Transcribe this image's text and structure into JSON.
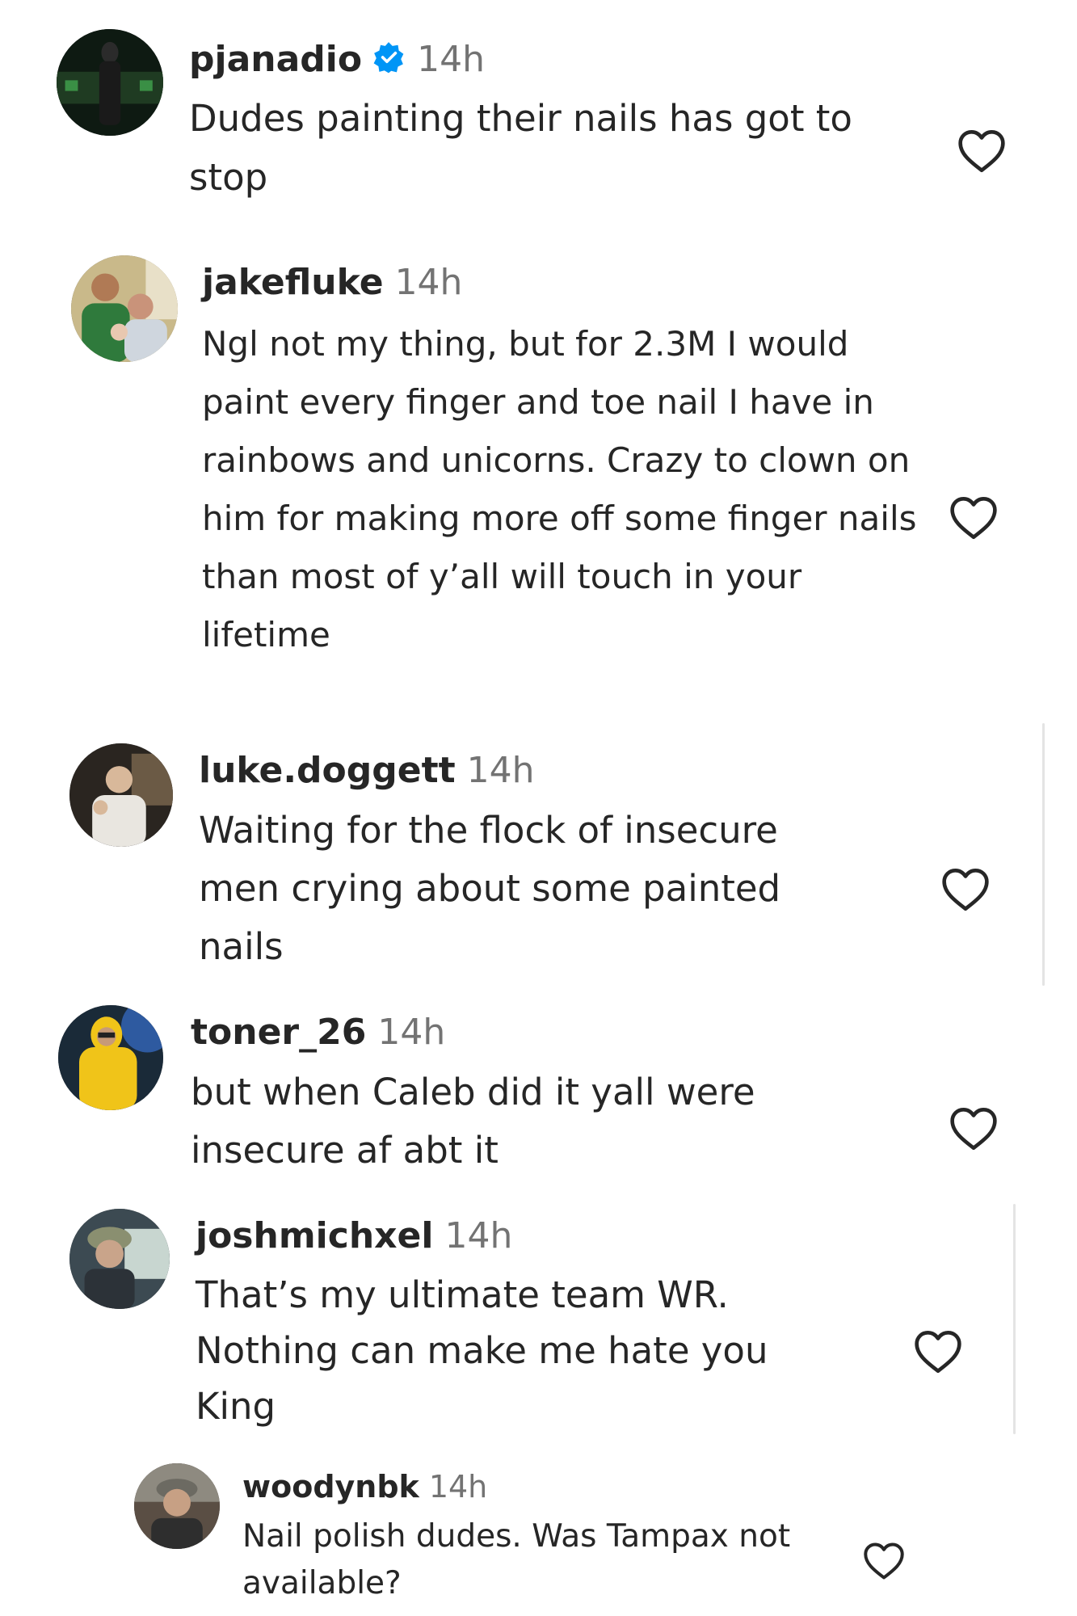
{
  "comments": [
    {
      "username": "pjanadio",
      "verified": true,
      "time": "14h",
      "text": "Dudes painting their nails has got to stop",
      "avatar_icon": "profile-photo",
      "like_icon": "heart-outline-icon"
    },
    {
      "username": "jakefluke",
      "verified": false,
      "time": "14h",
      "text": "Ngl not my thing, but for 2.3M I would paint every finger and toe nail I have in rainbows and unicorns. Crazy to clown on him for making more off some finger nails than most of y’all will touch in your lifetime",
      "avatar_icon": "profile-photo",
      "like_icon": "heart-outline-icon"
    },
    {
      "username": "luke.doggett",
      "verified": false,
      "time": "14h",
      "text": "Waiting for the flock of insecure men crying about some painted nails",
      "avatar_icon": "profile-photo",
      "like_icon": "heart-outline-icon"
    },
    {
      "username": "toner_26",
      "verified": false,
      "time": "14h",
      "text": "but when Caleb did it yall were insecure af abt it",
      "avatar_icon": "profile-photo",
      "like_icon": "heart-outline-icon"
    },
    {
      "username": "joshmichxel",
      "verified": false,
      "time": "14h",
      "text": "That’s my ultimate team WR. Nothing can make me hate you King",
      "avatar_icon": "profile-photo",
      "like_icon": "heart-outline-icon"
    },
    {
      "username": "woodynbk",
      "verified": false,
      "time": "14h",
      "text": "Nail polish dudes. Was Tampax not available?",
      "avatar_icon": "profile-photo",
      "like_icon": "heart-outline-icon"
    }
  ],
  "colors": {
    "text": "#262626",
    "muted": "#737373",
    "verified": "#0095f6"
  }
}
